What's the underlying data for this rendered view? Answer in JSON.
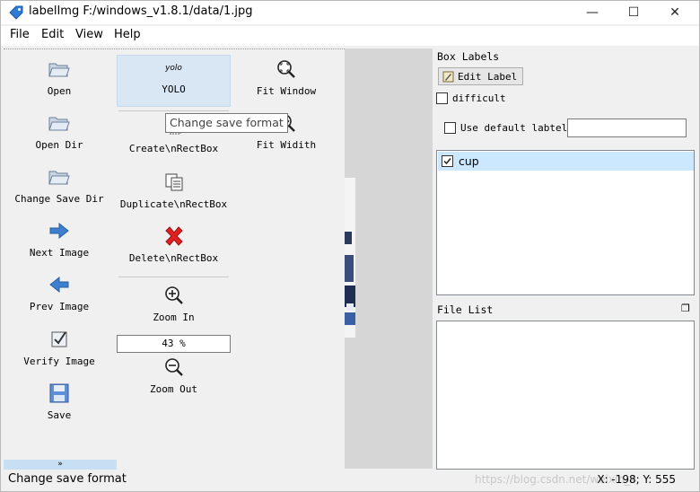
{
  "window": {
    "title": "labelImg F:/windows_v1.8.1/data/1.jpg",
    "minimize": "—",
    "maximize": "☐",
    "close": "✕"
  },
  "menu": {
    "file": "File",
    "edit": "Edit",
    "view": "View",
    "help": "Help"
  },
  "toolbar": {
    "open": "Open",
    "open_dir": "Open Dir",
    "change_save_dir": "Change Save Dir",
    "next_image": "Next Image",
    "prev_image": "Prev Image",
    "verify_image": "Verify Image",
    "save": "Save",
    "format_icon_text": "yolo",
    "format": "YOLO",
    "create_rectbox": "Create\\nRectBox",
    "duplicate_rectbox": "Duplicate\\nRectBox",
    "delete_rectbox": "Delete\\nRectBox",
    "zoom_in": "Zoom In",
    "zoom_value": "43 %",
    "zoom_out": "Zoom Out",
    "fit_window": "Fit Window",
    "fit_width": "Fit Widith",
    "more": "»",
    "tooltip": "Change save format"
  },
  "box_labels": {
    "title": "Box Labels",
    "edit_label": "Edit Label",
    "difficult": "difficult",
    "use_default": "Use default labtel",
    "default_value": "",
    "labels": [
      {
        "name": "cup",
        "checked": true
      }
    ]
  },
  "file_list": {
    "title": "File List",
    "float_icon": "❐"
  },
  "status": {
    "message": "Change save format",
    "coords": "X: -198; Y: 555",
    "watermark": "https://blog.csdn.net/weixin_4"
  },
  "colors": {
    "selection": "#cce8ff",
    "format_highlight": "#d9e7f5",
    "delete_red": "#e02020",
    "arrow_blue": "#3d7fd0"
  }
}
